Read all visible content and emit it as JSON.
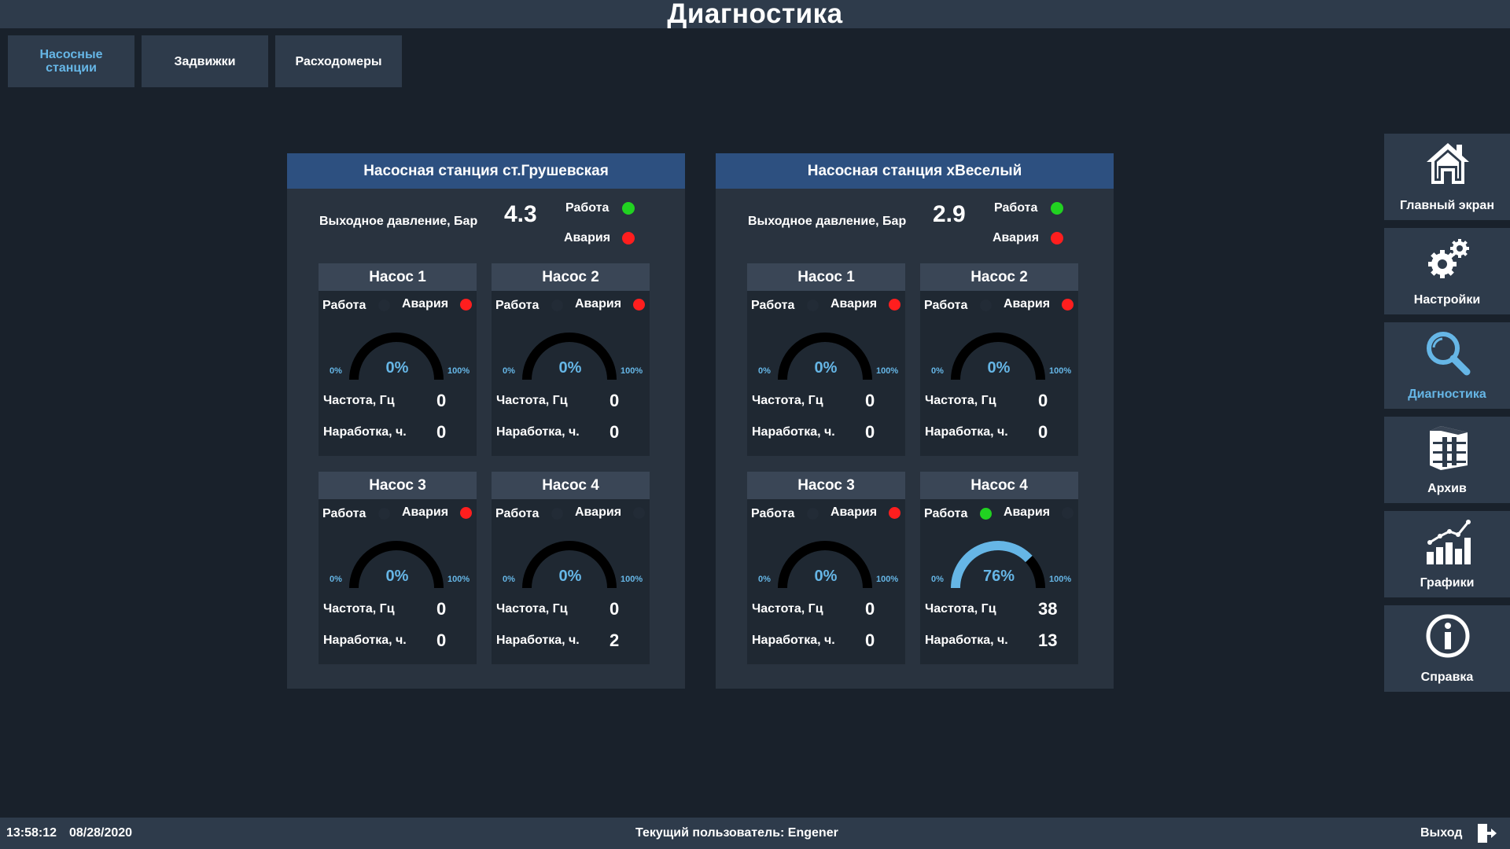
{
  "title": "Диагностика",
  "tabs": [
    {
      "label": "Насосные станции",
      "active": true
    },
    {
      "label": "Задвижки",
      "active": false
    },
    {
      "label": "Расходомеры",
      "active": false
    }
  ],
  "labels": {
    "pressure": "Выходное давление, Бар",
    "work": "Работа",
    "alarm": "Авария",
    "frequency": "Частота, Гц",
    "runtime": "Наработка, ч.",
    "gauge_min": "0%",
    "gauge_max": "100%"
  },
  "stations": [
    {
      "name": "Насосная станция ст.Грушевская",
      "pressure": "4.3",
      "work": "green",
      "alarm": "red",
      "pumps": [
        {
          "name": "Насос 1",
          "work": "off",
          "alarm": "red",
          "load": 0,
          "load_text": "0%",
          "frequency": "0",
          "runtime": "0"
        },
        {
          "name": "Насос 2",
          "work": "off",
          "alarm": "red",
          "load": 0,
          "load_text": "0%",
          "frequency": "0",
          "runtime": "0"
        },
        {
          "name": "Насос 3",
          "work": "off",
          "alarm": "red",
          "load": 0,
          "load_text": "0%",
          "frequency": "0",
          "runtime": "0"
        },
        {
          "name": "Насос 4",
          "work": "off",
          "alarm": "off",
          "load": 0,
          "load_text": "0%",
          "frequency": "0",
          "runtime": "2"
        }
      ]
    },
    {
      "name": "Насосная станция хВеселый",
      "pressure": "2.9",
      "work": "green",
      "alarm": "red",
      "pumps": [
        {
          "name": "Насос 1",
          "work": "off",
          "alarm": "red",
          "load": 0,
          "load_text": "0%",
          "frequency": "0",
          "runtime": "0"
        },
        {
          "name": "Насос 2",
          "work": "off",
          "alarm": "red",
          "load": 0,
          "load_text": "0%",
          "frequency": "0",
          "runtime": "0"
        },
        {
          "name": "Насос 3",
          "work": "off",
          "alarm": "red",
          "load": 0,
          "load_text": "0%",
          "frequency": "0",
          "runtime": "0"
        },
        {
          "name": "Насос 4",
          "work": "green",
          "alarm": "off",
          "load": 76,
          "load_text": "76%",
          "frequency": "38",
          "runtime": "13"
        }
      ]
    }
  ],
  "nav": [
    {
      "label": "Главный экран",
      "icon": "home-icon",
      "active": false
    },
    {
      "label": "Настройки",
      "icon": "gears-icon",
      "active": false
    },
    {
      "label": "Диагностика",
      "icon": "magnifier-icon",
      "active": true
    },
    {
      "label": "Архив",
      "icon": "archive-icon",
      "active": false
    },
    {
      "label": "Графики",
      "icon": "chart-icon",
      "active": false
    },
    {
      "label": "Справка",
      "icon": "info-icon",
      "active": false
    }
  ],
  "status": {
    "time": "13:58:12",
    "date": "08/28/2020",
    "user": "Текущий пользователь: Engener",
    "exit": "Выход"
  },
  "colors": {
    "background": "#19212b",
    "panel": "#29333f",
    "station_header": "#2d5080",
    "accent": "#66b6e6",
    "ok": "#21d221",
    "alarm": "#ff1e1e"
  }
}
